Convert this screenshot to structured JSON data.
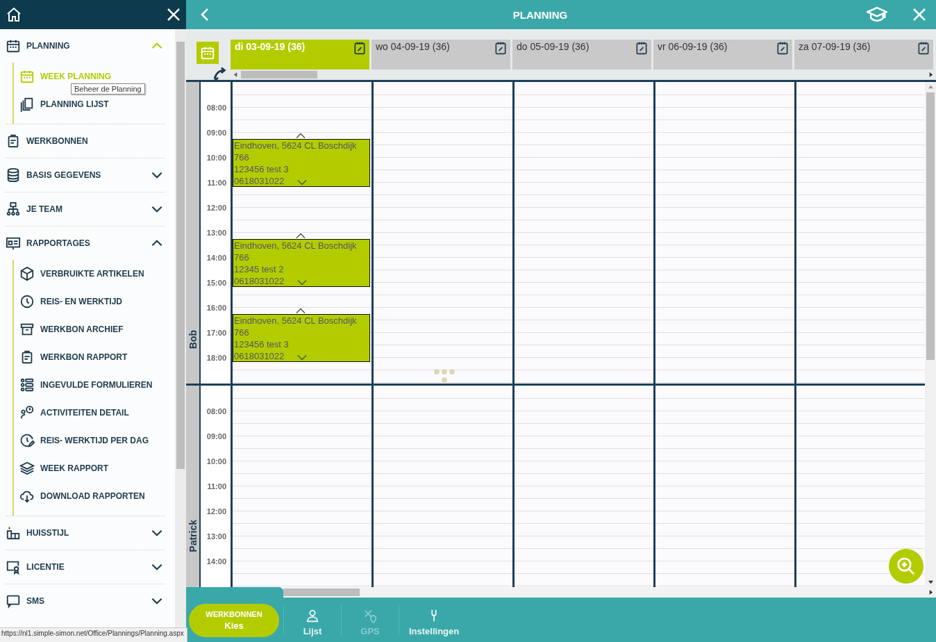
{
  "sidebar": {
    "items": [
      {
        "kind": "group",
        "label": "PLANNING",
        "expanded": true,
        "children": [
          {
            "label": "WEEK PLANNING",
            "selected": true
          },
          {
            "label": "PLANNING LIJST",
            "selected": false
          }
        ]
      },
      {
        "kind": "link",
        "label": "WERKBONNEN"
      },
      {
        "kind": "group",
        "label": "BASIS GEGEVENS",
        "expanded": false
      },
      {
        "kind": "group",
        "label": "JE TEAM",
        "expanded": false
      },
      {
        "kind": "group",
        "label": "RAPPORTAGES",
        "expanded": true,
        "children": [
          {
            "label": "VERBRUIKTE ARTIKELEN",
            "selected": false
          },
          {
            "label": "REIS- EN WERKTIJD",
            "selected": false
          },
          {
            "label": "WERKBON ARCHIEF",
            "selected": false
          },
          {
            "label": "WERKBON RAPPORT",
            "selected": false
          },
          {
            "label": "INGEVULDE FORMULIEREN",
            "selected": false
          },
          {
            "label": "ACTIVITEITEN DETAIL",
            "selected": false
          },
          {
            "label": "REIS- WERKTIJD PER DAG",
            "selected": false
          },
          {
            "label": "WEEK RAPPORT",
            "selected": false
          },
          {
            "label": "DOWNLOAD RAPPORTEN",
            "selected": false
          }
        ]
      },
      {
        "kind": "group",
        "label": "HUISSTIJL",
        "expanded": false
      },
      {
        "kind": "group",
        "label": "LICENTIE",
        "expanded": false
      },
      {
        "kind": "group",
        "label": "SMS",
        "expanded": false
      }
    ],
    "tooltip": "Beheer de Planning"
  },
  "status_bar": "https://nl1.simple-simon.net/Office/Plannings/Planning.aspx",
  "header": {
    "title": "PLANNING"
  },
  "days": [
    {
      "label": "di 03-09-19 (36)",
      "selected": true
    },
    {
      "label": "wo 04-09-19 (36)",
      "selected": false
    },
    {
      "label": "do 05-09-19 (36)",
      "selected": false
    },
    {
      "label": "vr 06-09-19 (36)",
      "selected": false
    },
    {
      "label": "za 07-09-19 (36)",
      "selected": false
    }
  ],
  "resources": [
    {
      "name": "Bob",
      "hours": [
        "08:00",
        "09:00",
        "10:00",
        "11:00",
        "12:00",
        "13:00",
        "14:00",
        "15:00",
        "16:00",
        "17:00",
        "18:00"
      ],
      "day_events": [
        [
          {
            "address": "Eindhoven, 5624 CL Boschdijk 766",
            "title": "123456 test 3",
            "phone": "0618031022"
          },
          {
            "address": "Eindhoven, 5624 CL Boschdijk 766",
            "title": "12345 test 2",
            "phone": "0618031022"
          },
          {
            "address": "Eindhoven, 5624 CL Boschdijk 766",
            "title": "123456 test 3",
            "phone": "0618031022"
          }
        ]
      ]
    },
    {
      "name": "Patrick",
      "hours": [
        "08:00",
        "09:00",
        "10:00",
        "11:00",
        "12:00",
        "13:00",
        "14:00"
      ]
    }
  ],
  "bottom_bar": {
    "main_button": {
      "label": "WERKBONNEN",
      "sublabel": "Kies"
    },
    "nav": [
      {
        "label": "Lijst",
        "disabled": false
      },
      {
        "label": "GPS",
        "disabled": true
      },
      {
        "label": "Instellingen",
        "disabled": false
      }
    ]
  }
}
